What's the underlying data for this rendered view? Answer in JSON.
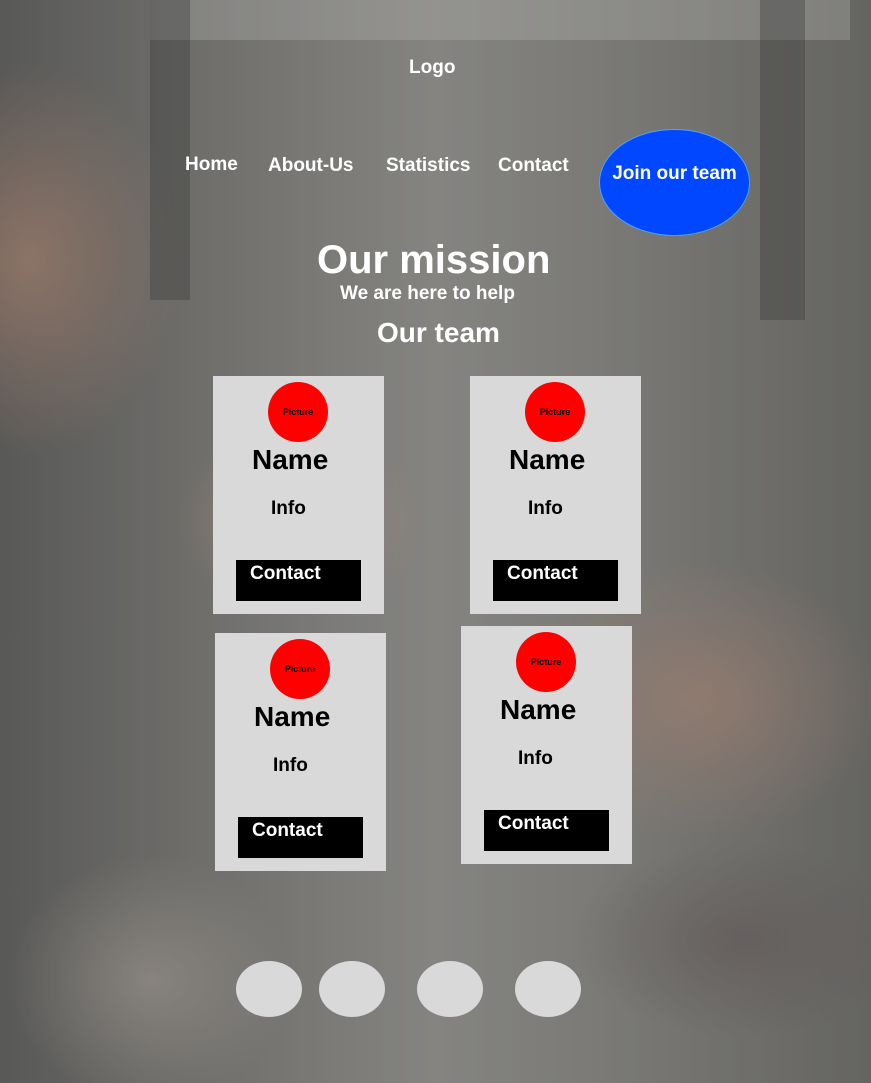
{
  "header": {
    "logo": "Logo"
  },
  "nav": {
    "home": "Home",
    "about": "About-Us",
    "statistics": "Statistics",
    "contact": "Contact",
    "join": "Join our team"
  },
  "hero": {
    "title": "Our mission",
    "subtitle": "We are here to help",
    "team_title": "Our team"
  },
  "team": [
    {
      "picture": "Picture",
      "name": "Name",
      "info": "Info",
      "contact": "Contact"
    },
    {
      "picture": "Picture",
      "name": "Name",
      "info": "Info",
      "contact": "Contact"
    },
    {
      "picture": "Picture",
      "name": "Name",
      "info": "Info",
      "contact": "Contact"
    },
    {
      "picture": "Picture",
      "name": "Name",
      "info": "Info",
      "contact": "Contact"
    }
  ],
  "colors": {
    "join_button": "#0047ff",
    "picture_circle": "#ff0000",
    "card_bg": "#d9d9d9",
    "contact_button": "#000000"
  }
}
